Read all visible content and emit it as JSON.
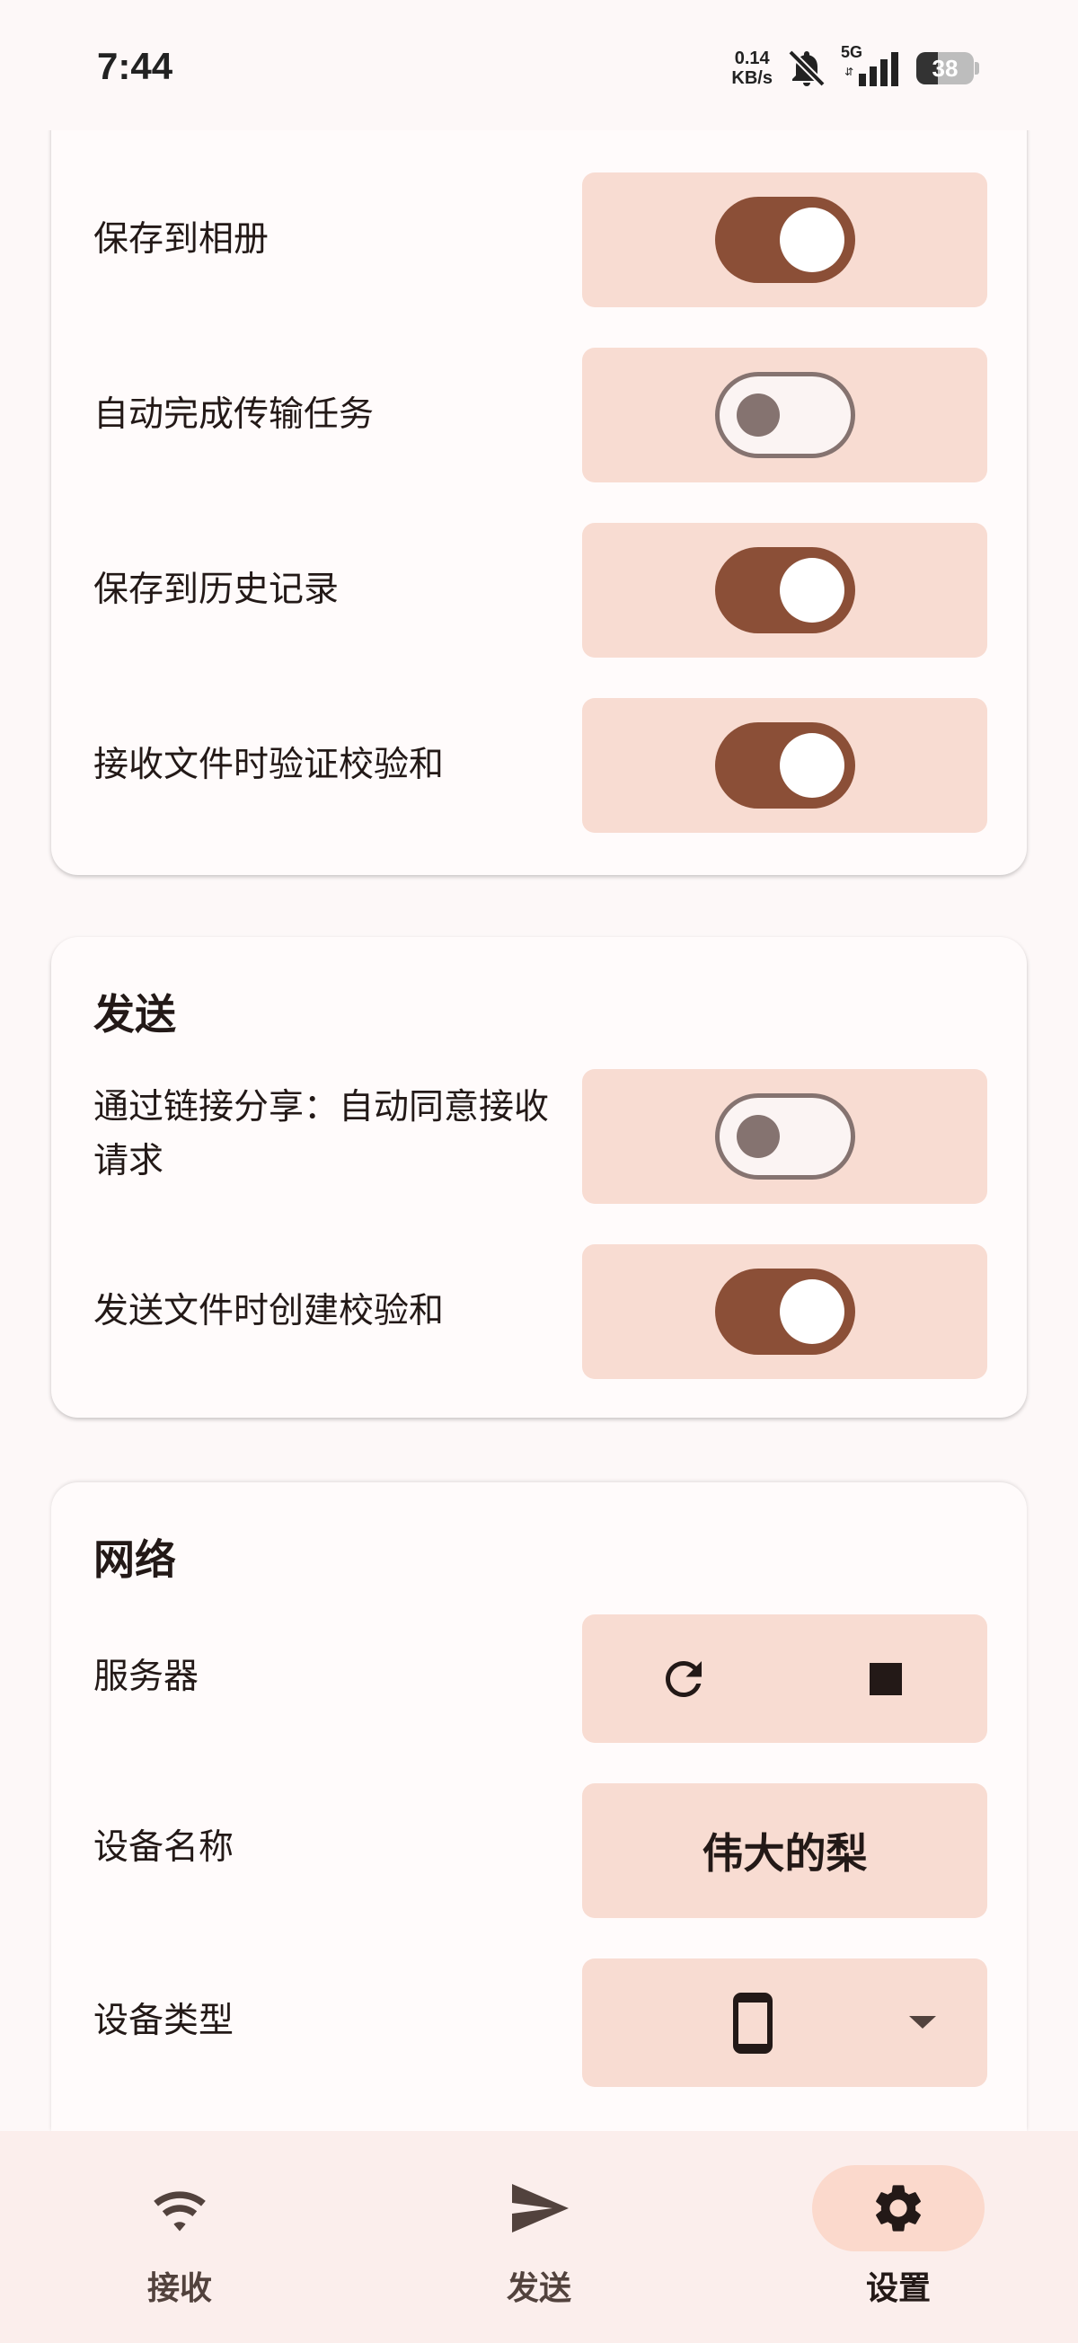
{
  "status_bar": {
    "time": "7:44",
    "net_speed_value": "0.14",
    "net_speed_unit": "KB/s",
    "network_type": "5G",
    "battery_level": "38",
    "icons": [
      "bell-muted-icon",
      "signal-icon",
      "battery-icon"
    ]
  },
  "receive_section": {
    "settings": [
      {
        "label": "保存到相册",
        "enabled": true
      },
      {
        "label": "自动完成传输任务",
        "enabled": false
      },
      {
        "label": "保存到历史记录",
        "enabled": true
      },
      {
        "label": "接收文件时验证校验和",
        "enabled": true
      }
    ]
  },
  "send_section": {
    "title": "发送",
    "settings": [
      {
        "label": "通过链接分享：自动同意接收请求",
        "enabled": false
      },
      {
        "label": "发送文件时创建校验和",
        "enabled": true
      }
    ]
  },
  "network_section": {
    "title": "网络",
    "server_label": "服务器",
    "server_actions": [
      "refresh-icon",
      "stop-icon"
    ],
    "device_name_label": "设备名称",
    "device_name_value": "伟大的梨",
    "device_type_label": "设备类型",
    "device_type_value": "phone-icon"
  },
  "bottom_nav": {
    "items": [
      {
        "label": "接收",
        "icon": "wifi-icon",
        "active": false
      },
      {
        "label": "发送",
        "icon": "send-icon",
        "active": false
      },
      {
        "label": "设置",
        "icon": "gear-icon",
        "active": true
      }
    ]
  },
  "colors": {
    "background": "#fdf8f8",
    "card": "#fffbfb",
    "row_box": "#f8dcd2",
    "switch_on": "#8b4f37",
    "switch_off_outline": "#857370",
    "nav_bar": "#fbeeec",
    "nav_active_pill": "#fbd9cc"
  }
}
